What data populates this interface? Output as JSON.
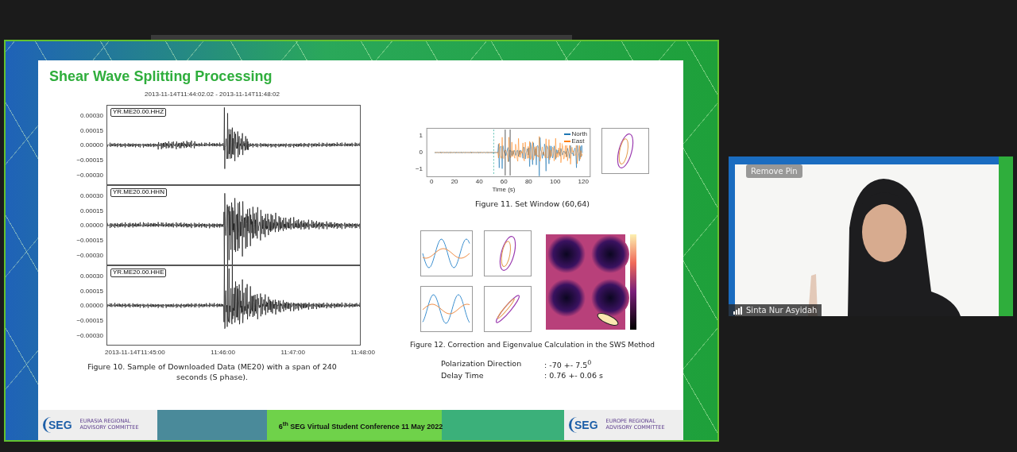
{
  "screen_share": {
    "slide": {
      "title": "Shear Wave Splitting Processing",
      "figure_10": {
        "plot_title": "2013-11-14T11:44:02.02  -  2013-11-14T11:48:02",
        "traces": [
          {
            "label": "YR.ME20.00.HHZ",
            "yticks": [
              "0.00030",
              "0.00015",
              "0.00000",
              "−0.00015",
              "−0.00030"
            ]
          },
          {
            "label": "YR.ME20.00.HHN",
            "yticks": [
              "0.00030",
              "0.00015",
              "0.00000",
              "−0.00015",
              "−0.00030"
            ]
          },
          {
            "label": "YR.ME20.00.HHE",
            "yticks": [
              "0.00030",
              "0.00015",
              "0.00000",
              "−0.00015",
              "−0.00030"
            ]
          }
        ],
        "xticks": [
          "2013-11-14T11:45:00",
          "11:46:00",
          "11:47:00",
          "11:48:00"
        ],
        "caption": "Figure 10. Sample of Downloaded Data (ME20) with a span of 240 seconds (S phase)."
      },
      "figure_11": {
        "legend": [
          {
            "name": "North",
            "color": "#1f77b4"
          },
          {
            "name": "East",
            "color": "#ff7f0e"
          }
        ],
        "xlabel": "Time (s)",
        "xticks": [
          "0",
          "20",
          "40",
          "60",
          "80",
          "100",
          "120"
        ],
        "yticks": [
          "1",
          "0",
          "−1"
        ],
        "caption": "Figure 11. Set Window (60,64)"
      },
      "figure_12": {
        "caption": "Figure 12. Correction and Eigenvalue Calculation in the SWS Method"
      },
      "results": [
        {
          "label": "Polarization Direction",
          "value": ": -70 +- 7.5$^{0}$"
        },
        {
          "label": "Delay Time",
          "value": ": 0.76 +- 0.06 s"
        }
      ]
    },
    "footer": {
      "left_logo": "SEG",
      "left_org": "EURASIA REGIONAL ADVISORY COMMITTEE",
      "center": "6$^{th}$ SEG Virtual Student Conference 11 May 2022",
      "right_logo": "SEG",
      "right_org": "EUROPE REGIONAL ADVISORY COMMITTEE"
    }
  },
  "video_tile": {
    "kind": "picture",
    "pin_button": "Remove Pin",
    "participant": "Sinta Nur Asyidah"
  }
}
